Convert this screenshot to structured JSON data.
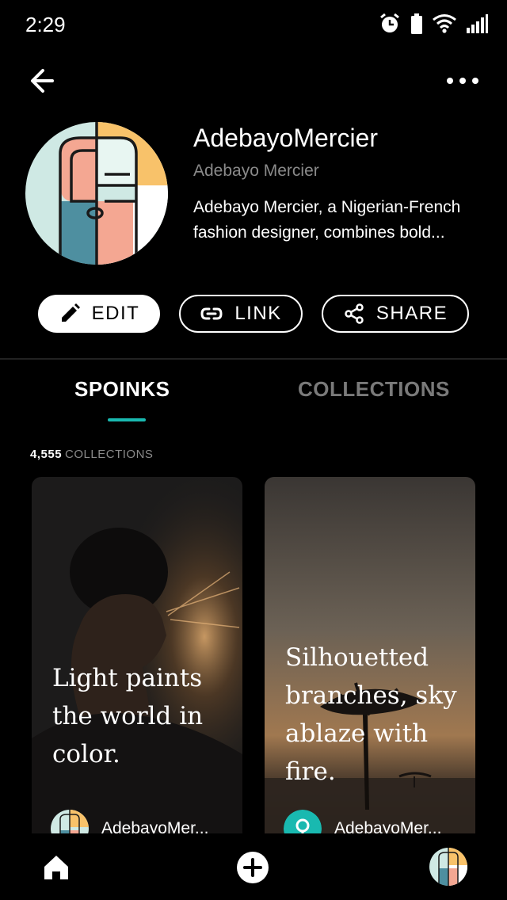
{
  "status_bar": {
    "time": "2:29",
    "icons": [
      "alarm-icon",
      "battery-icon",
      "wifi-icon",
      "signal-icon"
    ]
  },
  "top_bar": {
    "back_icon": "arrow-left-icon",
    "more_icon": "more-horizontal-icon"
  },
  "profile": {
    "username": "AdebayoMercier",
    "display_name": "Adebayo Mercier",
    "bio": "Adebayo Mercier, a Nigerian-French fashion designer, combines bold..."
  },
  "actions": {
    "edit_label": "EDIT",
    "link_label": "LINK",
    "share_label": "SHARE"
  },
  "tabs": {
    "active": "SPOINKS",
    "inactive": "COLLECTIONS"
  },
  "collections": {
    "count": "4,555",
    "label": "COLLECTIONS"
  },
  "cards": [
    {
      "text": "Light paints the world in color.",
      "author": "AdebayoMer..."
    },
    {
      "text": "Silhouetted branches, sky ablaze with fire.",
      "author": "AdebayoMer..."
    }
  ],
  "bottom_nav": {
    "items": [
      "home-icon",
      "add-icon",
      "profile-avatar"
    ]
  },
  "colors": {
    "accent": "#19b9b0",
    "background": "#000000",
    "muted_text": "#8a8a8a"
  }
}
